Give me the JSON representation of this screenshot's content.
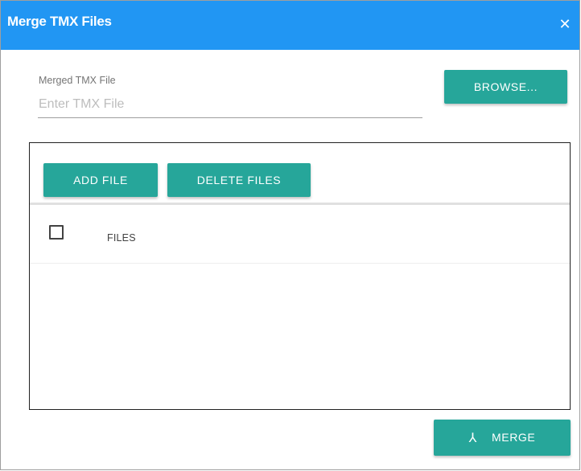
{
  "dialog": {
    "title": "Merge TMX Files",
    "close_glyph": "✕"
  },
  "merged_file": {
    "label": "Merged TMX File",
    "value": "",
    "placeholder": "Enter TMX File",
    "browse_label": "BROWSE..."
  },
  "files_panel": {
    "add_label": "ADD FILE",
    "delete_label": "DELETE FILES",
    "column_header": "FILES",
    "rows": []
  },
  "footer": {
    "merge_label": "MERGE",
    "merge_icon": "merge-icon",
    "merge_icon_glyph": "⅄"
  },
  "colors": {
    "titlebar": "#2196f3",
    "button": "#26a69a"
  }
}
